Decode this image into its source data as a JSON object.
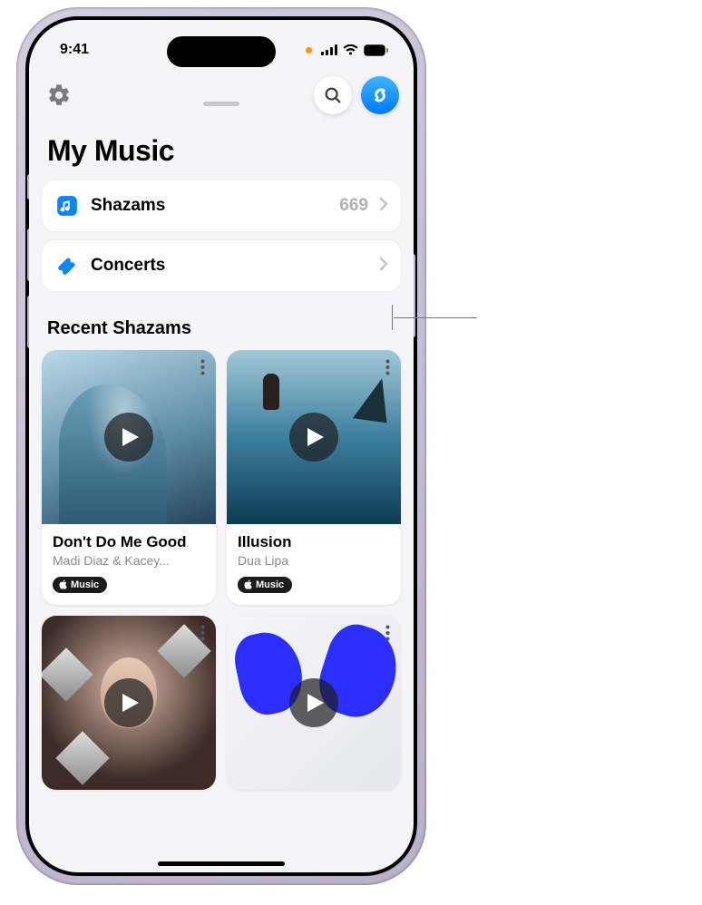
{
  "status": {
    "time": "9:41"
  },
  "pageTitle": "My Music",
  "rows": {
    "shazams": {
      "label": "Shazams",
      "count": "669"
    },
    "concerts": {
      "label": "Concerts"
    }
  },
  "recent": {
    "header": "Recent Shazams",
    "items": [
      {
        "title": "Don't Do Me Good",
        "artist": "Madi Diaz & Kacey...",
        "badge": "Music"
      },
      {
        "title": "Illusion",
        "artist": "Dua Lipa",
        "badge": "Music"
      }
    ]
  }
}
